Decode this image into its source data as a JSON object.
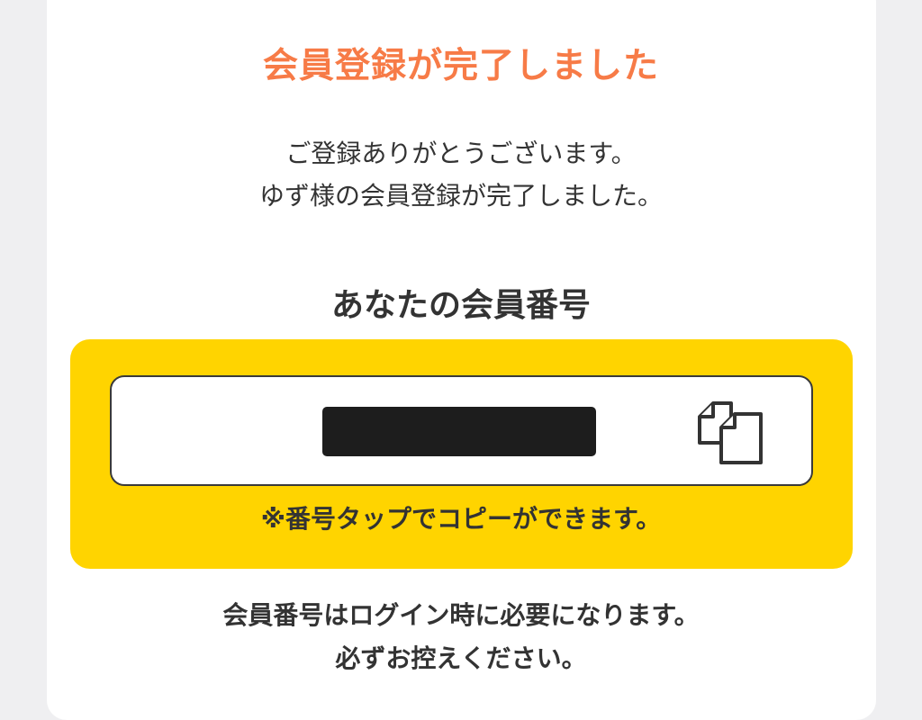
{
  "completion": {
    "title": "会員登録が完了しました",
    "thanks_line1": "ご登録ありがとうございます。",
    "thanks_line2": "ゆず様の会員登録が完了しました。"
  },
  "member_number": {
    "heading": "あなたの会員番号",
    "value": "",
    "copy_icon": "copy-icon",
    "copy_hint": "※番号タップでコピーができます。"
  },
  "notice": {
    "line1": "会員番号はログイン時に必要になります。",
    "line2": "必ずお控えください。"
  },
  "colors": {
    "title": "#f77b47",
    "panel": "#ffd400",
    "text": "#333333",
    "background": "#efeff1"
  }
}
